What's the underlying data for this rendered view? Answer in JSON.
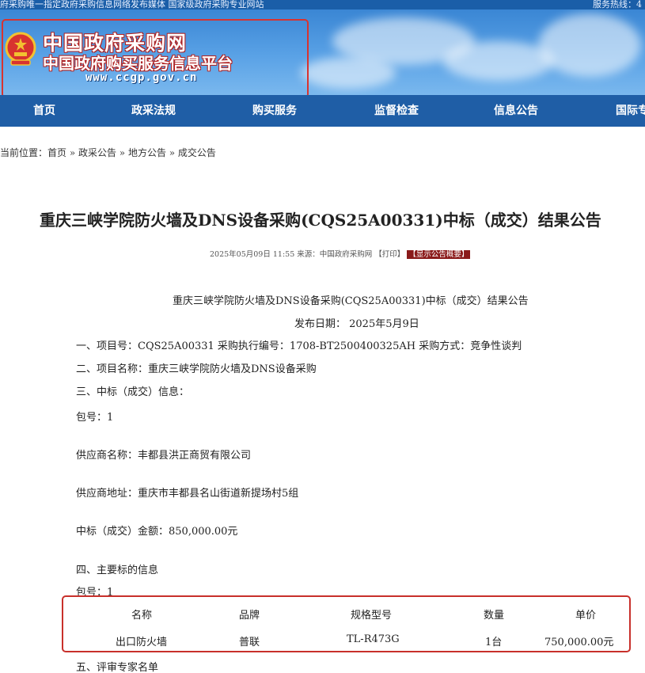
{
  "top_strip": {
    "left_text": "府采购唯一指定政府采购信息网络发布媒体 国家级政府采购专业网站",
    "right_text": "服务热线：4"
  },
  "site": {
    "name": "中国政府采购网",
    "subtitle": "中国政府购买服务信息平台",
    "url": "www.ccgp.gov.cn"
  },
  "nav": [
    "首页",
    "政采法规",
    "购买服务",
    "监督检查",
    "信息公告",
    "国际专"
  ],
  "breadcrumb": "当前位置：首页 » 政采公告 » 地方公告 » 成交公告",
  "article": {
    "title": "重庆三峡学院防火墙及DNS设备采购(CQS25A00331)中标（成交）结果公告",
    "meta_prefix": "2025年05月09日 11:55 来源：中国政府采购网 【打印】",
    "meta_summary": "【显示公告概要】",
    "doc_title": "重庆三峡学院防火墙及DNS设备采购(CQS25A00331)中标（成交）结果公告",
    "pub_date": "发布日期：  2025年5月9日",
    "line1": "一、项目号：CQS25A00331      采购执行编号：1708-BT2500400325AH      采购方式：竞争性谈判",
    "line2": "二、项目名称：重庆三峡学院防火墙及DNS设备采购",
    "line3": "三、中标（成交）信息：",
    "package1": "包号：1",
    "supplier_name": "供应商名称：丰都县洪正商贸有限公司",
    "supplier_addr": "供应商地址：重庆市丰都县名山街道新提场村5组",
    "amount": "中标（成交）金额：850,000.00元",
    "section4": "四、主要标的信息",
    "package2": "包号：1",
    "section5": "五、评审专家名单"
  },
  "table": {
    "headers": [
      "名称",
      "品牌",
      "规格型号",
      "数量",
      "单价"
    ],
    "row": [
      "出口防火墙",
      "普联",
      "TL-R473G",
      "1台",
      "750,000.00元"
    ]
  },
  "colors": {
    "nav_bg": "#1f5ea6",
    "highlight_border": "#c8302b",
    "summary_badge": "#8a1a1a"
  }
}
